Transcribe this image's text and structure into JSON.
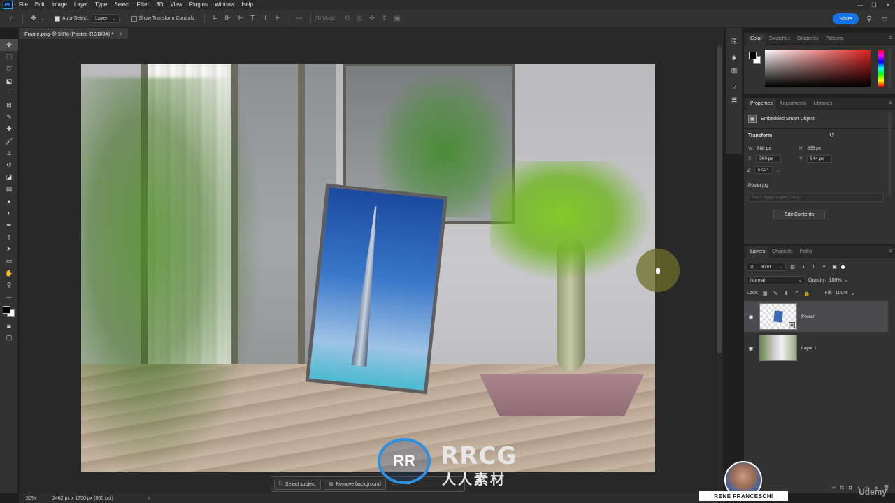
{
  "menubar": {
    "app_icon": "Ps",
    "items": [
      "File",
      "Edit",
      "Image",
      "Layer",
      "Type",
      "Select",
      "Filter",
      "3D",
      "View",
      "Plugins",
      "Window",
      "Help"
    ]
  },
  "options": {
    "auto_select_label": "Auto-Select:",
    "auto_select_target": "Layer",
    "show_transform_label": "Show Transform Controls",
    "mode_3d_label": "3D Mode:",
    "share_label": "Share"
  },
  "document": {
    "tab_title": "Frame.png @ 50% (Poster, RGB/8#) *",
    "zoom": "50%",
    "doc_size": "2462 px x 1750 px (300 ppi)"
  },
  "taskbar": {
    "select_subject": "Select subject",
    "remove_background": "Remove background"
  },
  "watermark": {
    "logo_text": "RRCG",
    "sub_text": "人人素材"
  },
  "color_panel": {
    "tabs": [
      "Color",
      "Swatches",
      "Gradients",
      "Patterns"
    ],
    "active_tab": "Color",
    "foreground": "#000000",
    "background": "#ffffff",
    "hue_color": "#e02020"
  },
  "properties_panel": {
    "tabs": [
      "Properties",
      "Adjustments",
      "Libraries"
    ],
    "active_tab": "Properties",
    "object_type": "Embedded Smart Object",
    "transform_title": "Transform",
    "w_label": "W:",
    "w": "588 px",
    "h_label": "H:",
    "h": "855 px",
    "x_label": "X:",
    "x": "960 px",
    "y_label": "Y:",
    "y": "544 px",
    "angle": "5.03°",
    "file_name": "Poster.jpg",
    "layer_comp": "Don't Apply Layer Comp",
    "edit_contents": "Edit Contents"
  },
  "layers_panel": {
    "tabs": [
      "Layers",
      "Channels",
      "Paths"
    ],
    "active_tab": "Layers",
    "kind_label": "Kind",
    "blend_mode": "Normal",
    "opacity_label": "Opacity:",
    "opacity": "100%",
    "lock_label": "Lock:",
    "fill_label": "Fill:",
    "fill": "100%",
    "layers": [
      {
        "name": "Poster",
        "selected": true
      },
      {
        "name": "Layer 1",
        "selected": false
      }
    ]
  },
  "presenter": {
    "name": "RENÉ FRANCESCHI"
  },
  "brand": {
    "udemy": "Udemy"
  },
  "colors": {
    "accent": "#1473e6",
    "panel_bg": "#323232",
    "canvas_bg": "#282828"
  }
}
